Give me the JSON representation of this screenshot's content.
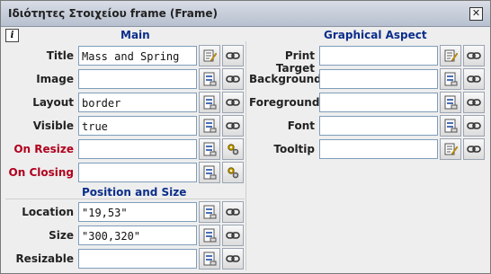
{
  "window": {
    "title": "Ιδιότητες Στοιχείου frame (Frame)",
    "close_glyph": "✕"
  },
  "info": {
    "glyph": "i"
  },
  "sections": {
    "main": "Main",
    "graphical": "Graphical Aspect",
    "position": "Position and Size"
  },
  "main_rows": [
    {
      "label": "Title",
      "value": "Mass and Spring",
      "color": "normal",
      "btn1": "edit-text-icon",
      "btn2": "link-icon"
    },
    {
      "label": "Image",
      "value": "",
      "color": "normal",
      "btn1": "browse-icon",
      "btn2": "link-icon"
    },
    {
      "label": "Layout",
      "value": "border",
      "color": "normal",
      "btn1": "browse-icon",
      "btn2": "link-icon"
    },
    {
      "label": "Visible",
      "value": "true",
      "color": "normal",
      "btn1": "browse-icon",
      "btn2": "link-icon"
    },
    {
      "label": "On Resize",
      "value": "",
      "color": "red",
      "btn1": "browse-icon",
      "btn2": "gear-icon"
    },
    {
      "label": "On Closing",
      "value": "",
      "color": "red",
      "btn1": "browse-icon",
      "btn2": "gear-icon"
    }
  ],
  "position_rows": [
    {
      "label": "Location",
      "value": "\"19,53\"",
      "btn1": "browse-icon",
      "btn2": "link-icon"
    },
    {
      "label": "Size",
      "value": "\"300,320\"",
      "btn1": "browse-icon",
      "btn2": "link-icon"
    },
    {
      "label": "Resizable",
      "value": "",
      "btn1": "browse-icon",
      "btn2": "link-icon"
    }
  ],
  "graphical_rows": [
    {
      "label": "Print Target",
      "value": "",
      "btn1": "edit-text-icon",
      "btn2": "link-icon"
    },
    {
      "label": "Background",
      "value": "",
      "btn1": "browse-icon",
      "btn2": "link-icon"
    },
    {
      "label": "Foreground",
      "value": "",
      "btn1": "browse-icon",
      "btn2": "link-icon"
    },
    {
      "label": "Font",
      "value": "",
      "btn1": "browse-icon",
      "btn2": "link-icon"
    },
    {
      "label": "Tooltip",
      "value": "",
      "btn1": "edit-text-icon",
      "btn2": "link-icon"
    }
  ]
}
